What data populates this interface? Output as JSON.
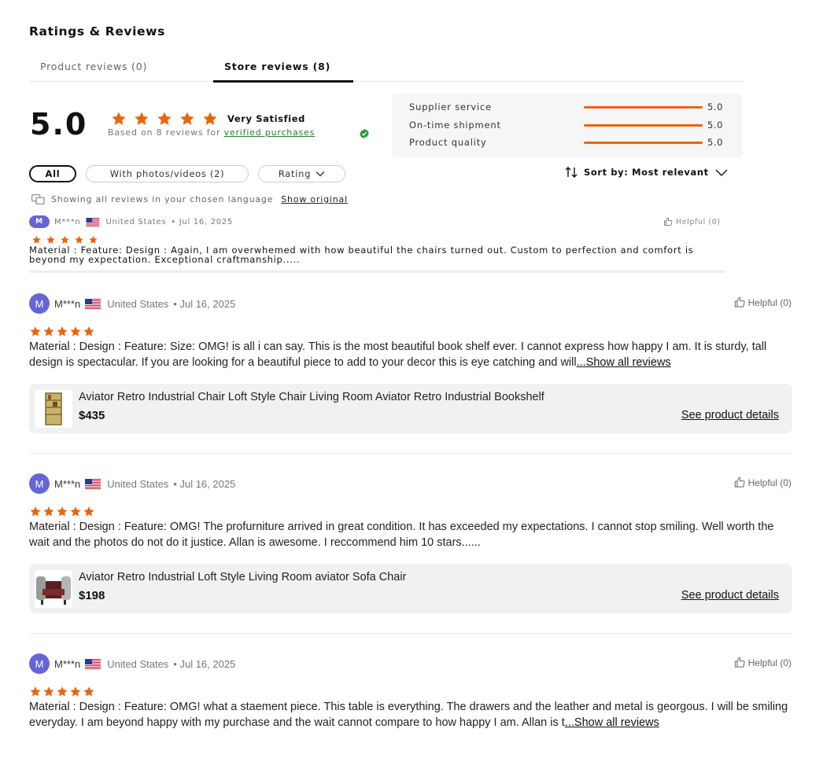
{
  "section_title": "Ratings & Reviews",
  "tabs": [
    {
      "label": "Product reviews (0)",
      "active": false
    },
    {
      "label": "Store reviews (8)",
      "active": true
    }
  ],
  "summary": {
    "score": "5.0",
    "star_rating": 5,
    "verdict": "Very Satisfied",
    "based_prefix": "Based on 8 reviews for",
    "based_link": "verified purchases"
  },
  "metrics": [
    {
      "label": "Supplier service",
      "value": "5.0",
      "fraction": 1.0
    },
    {
      "label": "On-time shipment",
      "value": "5.0",
      "fraction": 1.0
    },
    {
      "label": "Product quality",
      "value": "5.0",
      "fraction": 1.0
    }
  ],
  "filters": {
    "all": "All",
    "photos": "With photos/videos (2)",
    "rating": "Rating",
    "sort": "Sort by: Most relevant"
  },
  "language_note": {
    "text": "Showing all reviews in your chosen language",
    "link": "Show original"
  },
  "colors": {
    "accent": "#e8650f",
    "avatar": "#6566d6",
    "verified": "#2a7d2a"
  },
  "preview_review": {
    "avatar_letter": "M",
    "name": "M***n",
    "country": "United States",
    "date": "• Jul 16, 2025",
    "helpful": "Helpful (0)",
    "stars": 5,
    "text": "Material :  Feature:  Design : Again, I am overwhemed with how beautiful the chairs turned out. Custom to perfection and comfort is beyond my expectation. Exceptional craftmanship....."
  },
  "reviews": [
    {
      "avatar_letter": "M",
      "name": "M***n",
      "country": "United States",
      "date": "• Jul 16, 2025",
      "helpful": "Helpful (0)",
      "stars": 5,
      "text": "Material :  Design :  Feature:  Size: OMG! is all i can say. This is the most beautiful book shelf ever. I cannot express how happy I am. It is sturdy, tall design is spectacular. If you are looking for a beautiful piece to add to your decor this is eye catching and will",
      "more": "...Show all reviews",
      "product_title": "Aviator Retro Industrial Chair Loft Style Chair Living Room Aviator Retro Industrial Bookshelf",
      "product_price": "$435",
      "product_link": "See product details",
      "thumb_icon": "bookshelf-thumbnail"
    },
    {
      "avatar_letter": "M",
      "name": "M***n",
      "country": "United States",
      "date": "• Jul 16, 2025",
      "helpful": "Helpful (0)",
      "stars": 5,
      "text": "Material :  Design :  Feature:  OMG! The profurniture arrived in great condition. It has exceeded my expectations. I cannot stop smiling. Well worth the wait and the photos do not do it justice. Allan is awesome. I reccommend him 10 stars......",
      "product_title": "Aviator Retro Industrial Loft Style Living Room aviator Sofa Chair",
      "product_price": "$198",
      "product_link": "See product details",
      "thumb_icon": "sofa-chair-thumbnail"
    },
    {
      "avatar_letter": "M",
      "name": "M***n",
      "country": "United States",
      "date": "• Jul 16, 2025",
      "helpful": "Helpful (0)",
      "stars": 5,
      "text": "Material :  Design :  Feature: OMG! what a staement piece. This table is everything. The drawers and the leather and metal is georgous. I will be smiling everyday. I am beyond happy with my purchase and the wait cannot compare to how happy I am. Allan is t",
      "more": "...Show all reviews"
    }
  ]
}
